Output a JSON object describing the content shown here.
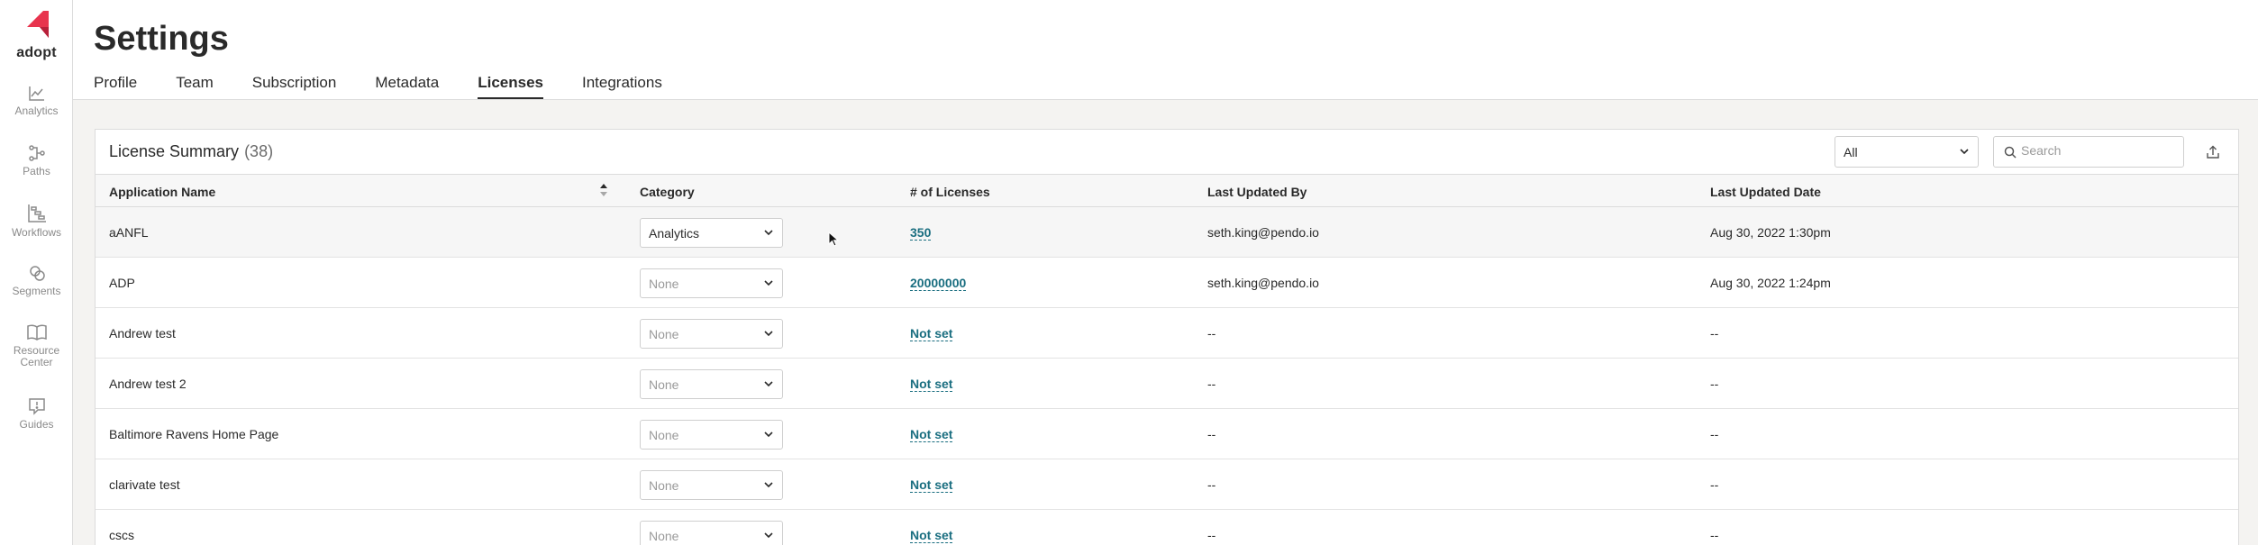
{
  "sidebar": {
    "logo_text": "adopt",
    "items": [
      {
        "label": "Analytics"
      },
      {
        "label": "Paths"
      },
      {
        "label": "Workflows"
      },
      {
        "label": "Segments"
      },
      {
        "label": "Resource Center"
      },
      {
        "label": "Guides"
      }
    ]
  },
  "header": {
    "title": "Settings",
    "tabs": [
      {
        "label": "Profile"
      },
      {
        "label": "Team"
      },
      {
        "label": "Subscription"
      },
      {
        "label": "Metadata"
      },
      {
        "label": "Licenses",
        "active": true
      },
      {
        "label": "Integrations"
      }
    ]
  },
  "summary": {
    "title": "License Summary",
    "count": "(38)",
    "filter_value": "All",
    "search_placeholder": "Search"
  },
  "table": {
    "columns": [
      "Application Name",
      "Category",
      "# of Licenses",
      "Last Updated By",
      "Last Updated Date"
    ],
    "rows": [
      {
        "name": "aANFL",
        "category": "Analytics",
        "licenses": "350",
        "updated_by": "seth.king@pendo.io",
        "updated_date": "Aug 30, 2022 1:30pm"
      },
      {
        "name": "ADP",
        "category": "None",
        "licenses": "20000000",
        "updated_by": "seth.king@pendo.io",
        "updated_date": "Aug 30, 2022 1:24pm"
      },
      {
        "name": "Andrew test",
        "category": "None",
        "licenses": "Not set",
        "updated_by": "--",
        "updated_date": "--"
      },
      {
        "name": "Andrew test 2",
        "category": "None",
        "licenses": "Not set",
        "updated_by": "--",
        "updated_date": "--"
      },
      {
        "name": "Baltimore Ravens Home Page",
        "category": "None",
        "licenses": "Not set",
        "updated_by": "--",
        "updated_date": "--"
      },
      {
        "name": "clarivate test",
        "category": "None",
        "licenses": "Not set",
        "updated_by": "--",
        "updated_date": "--"
      },
      {
        "name": "cscs",
        "category": "None",
        "licenses": "Not set",
        "updated_by": "--",
        "updated_date": "--"
      }
    ]
  },
  "colors": {
    "brand": "#e8344e",
    "link": "#1a6e80"
  }
}
